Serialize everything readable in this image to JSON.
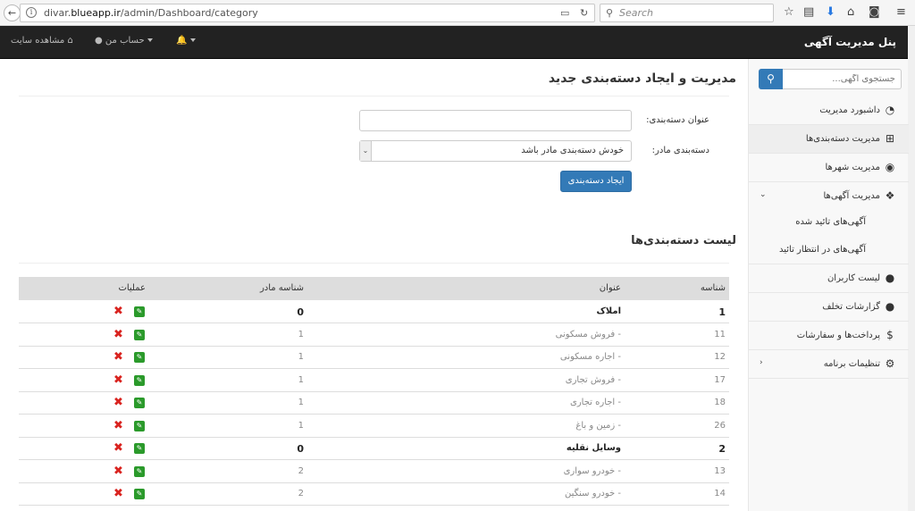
{
  "browser": {
    "back_glyph": "←",
    "info_glyph": "i",
    "url_prefix": "divar.",
    "url_host": "blueapp.ir",
    "url_path": "/admin/Dashboard/category",
    "search_placeholder": "Search"
  },
  "navbar": {
    "brand": "پنل مدیریت آگهی",
    "view_site": "مشاهده سایت",
    "account": "حساب من"
  },
  "sidebar": {
    "search_placeholder": "جستجوی آگهی...",
    "items": [
      {
        "label": "داشبورد مدیریت",
        "icon": "dashboard-icon"
      },
      {
        "label": "مدیریت دسته‌بندی‌ها",
        "icon": "sitemap-icon"
      },
      {
        "label": "مدیریت شهرها",
        "icon": "map-marker-icon"
      },
      {
        "label": "مدیریت آگهی‌ها",
        "icon": "cubes-icon"
      },
      {
        "label": "آگهی‌های تائید شده"
      },
      {
        "label": "آگهی‌های در انتظار تائید"
      },
      {
        "label": "لیست کاربران",
        "icon": "user-icon"
      },
      {
        "label": "گزارشات تخلف",
        "icon": "comment-icon"
      },
      {
        "label": "پرداخت‌ها و سفارشات",
        "icon": "dollar-icon"
      },
      {
        "label": "تنظیمات برنامه",
        "icon": "gear-icon"
      }
    ]
  },
  "main": {
    "title": "مدیریت و ایجاد دسته‌بندی جدید",
    "form": {
      "title_label": "عنوان دسته‌بندی:",
      "title_value": "",
      "parent_label": "دسته‌بندی مادر:",
      "parent_value": "خودش دسته‌بندی مادر باشد",
      "submit": "ایجاد دسته‌بندی"
    },
    "list_title": "لیست دسته‌بندی‌ها",
    "table": {
      "headers": {
        "id": "شناسه",
        "title": "عنوان",
        "parent_id": "شناسه مادر",
        "actions": "عملیات"
      },
      "rows": [
        {
          "id": "1",
          "title": "املاک",
          "parent_id": "0",
          "level": "parent"
        },
        {
          "id": "11",
          "title": "-  فروش مسکونی",
          "parent_id": "1",
          "level": "child"
        },
        {
          "id": "12",
          "title": "-  اجاره مسکونی",
          "parent_id": "1",
          "level": "child"
        },
        {
          "id": "17",
          "title": "-  فروش تجاری",
          "parent_id": "1",
          "level": "child"
        },
        {
          "id": "18",
          "title": "-  اجاره تجاری",
          "parent_id": "1",
          "level": "child"
        },
        {
          "id": "26",
          "title": "-  زمین و باغ",
          "parent_id": "1",
          "level": "child"
        },
        {
          "id": "2",
          "title": "وسایل نقلیه",
          "parent_id": "0",
          "level": "parent"
        },
        {
          "id": "13",
          "title": "-  خودرو سواری",
          "parent_id": "2",
          "level": "child"
        },
        {
          "id": "14",
          "title": "-  خودرو سنگین",
          "parent_id": "2",
          "level": "child"
        }
      ]
    }
  },
  "colors": {
    "primary": "#337ab7",
    "navbar": "#222222",
    "edit": "#2b9a2b",
    "delete": "#d9231f"
  }
}
